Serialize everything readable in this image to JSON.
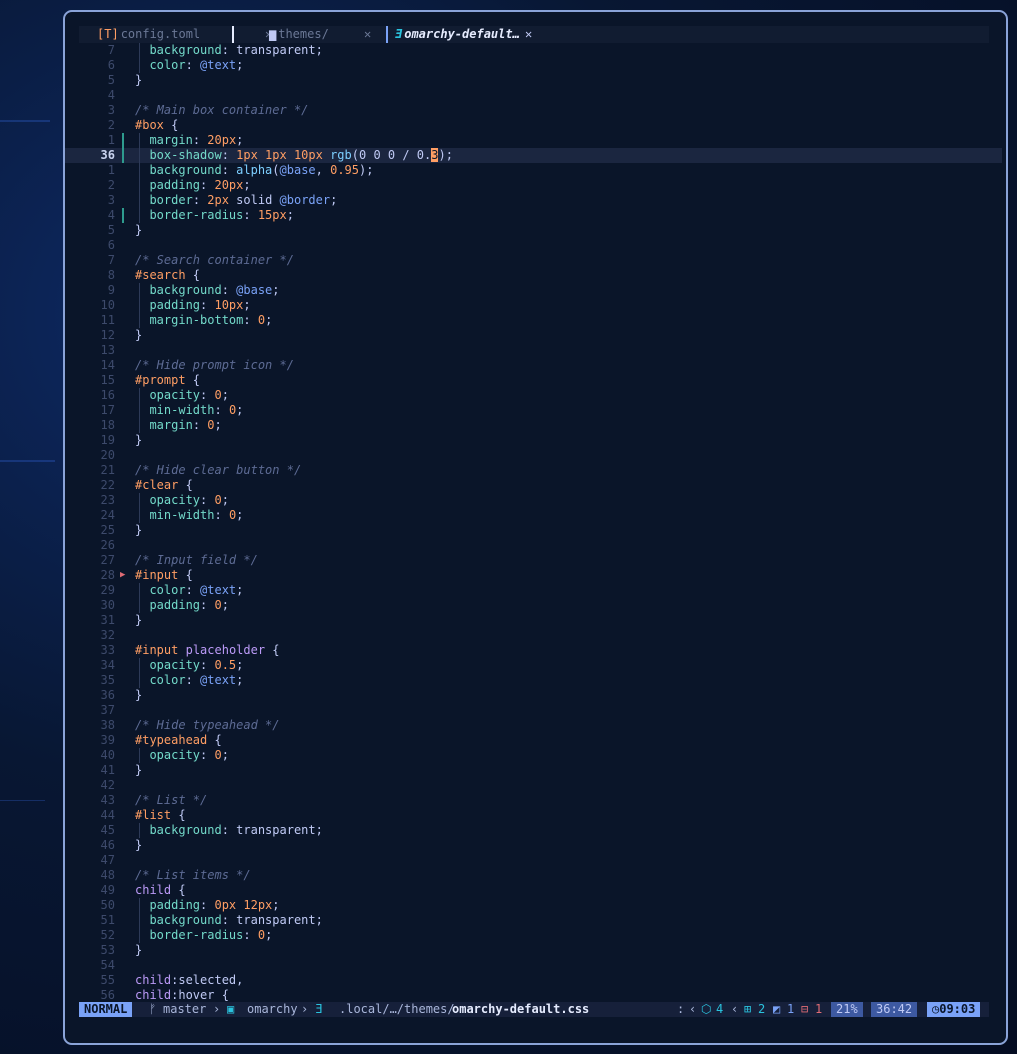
{
  "tabs": [
    {
      "icon": "[T]",
      "label": "config.toml",
      "close": "✕"
    },
    {
      "icon": "▆",
      "label": "themes/",
      "close": "✕"
    },
    {
      "icon": "Ǝ",
      "label": "omarchy-default…",
      "close": "✕"
    }
  ],
  "lines": [
    {
      "n": "7",
      "t": [
        [
          "  "
        ],
        [
          "background",
          "prop"
        ],
        [
          ": "
        ],
        [
          "transparent",
          "kw"
        ],
        [
          ";"
        ]
      ],
      "g": 1
    },
    {
      "n": "6",
      "t": [
        [
          "  "
        ],
        [
          "color",
          "prop"
        ],
        [
          ": "
        ],
        [
          "@text",
          "var"
        ],
        [
          ";"
        ]
      ],
      "g": 1
    },
    {
      "n": "5",
      "t": [
        [
          "}"
        ]
      ]
    },
    {
      "n": "4",
      "t": [
        [
          ""
        ]
      ]
    },
    {
      "n": "3",
      "t": [
        [
          "/* Main box container */",
          "cm"
        ]
      ]
    },
    {
      "n": "2",
      "t": [
        [
          "#box",
          "sel"
        ],
        [
          " {"
        ]
      ]
    },
    {
      "n": "1",
      "t": [
        [
          "  "
        ],
        [
          "margin",
          "prop"
        ],
        [
          ": "
        ],
        [
          "20px",
          "num"
        ],
        [
          ";"
        ]
      ],
      "g": 1,
      "s": 1
    },
    {
      "n": "36",
      "cur": 1,
      "t": [
        [
          "  "
        ],
        [
          "box-shadow",
          "prop"
        ],
        [
          ": "
        ],
        [
          "1px 1px 10px ",
          "num"
        ],
        [
          "rgb",
          "fn"
        ],
        [
          "(0 0 0 / 0."
        ],
        [
          "3",
          "cursor"
        ],
        [
          ");"
        ]
      ],
      "g": 1,
      "s": 1
    },
    {
      "n": "1",
      "t": [
        [
          "  "
        ],
        [
          "background",
          "prop"
        ],
        [
          ": "
        ],
        [
          "alpha",
          "fn"
        ],
        [
          "("
        ],
        [
          "@base",
          "var"
        ],
        [
          ", "
        ],
        [
          "0.95",
          "num"
        ],
        [
          ");"
        ]
      ],
      "g": 1
    },
    {
      "n": "2",
      "t": [
        [
          "  "
        ],
        [
          "padding",
          "prop"
        ],
        [
          ": "
        ],
        [
          "20px",
          "num"
        ],
        [
          ";"
        ]
      ],
      "g": 1
    },
    {
      "n": "3",
      "t": [
        [
          "  "
        ],
        [
          "border",
          "prop"
        ],
        [
          ": "
        ],
        [
          "2px",
          "num"
        ],
        [
          " solid "
        ],
        [
          "@border",
          "var"
        ],
        [
          ";"
        ]
      ],
      "g": 1
    },
    {
      "n": "4",
      "t": [
        [
          "  "
        ],
        [
          "border-radius",
          "prop"
        ],
        [
          ": "
        ],
        [
          "15px",
          "num"
        ],
        [
          ";"
        ]
      ],
      "g": 1,
      "s": 1
    },
    {
      "n": "5",
      "t": [
        [
          "}"
        ]
      ]
    },
    {
      "n": "6",
      "t": [
        [
          ""
        ]
      ]
    },
    {
      "n": "7",
      "t": [
        [
          "/* Search container */",
          "cm"
        ]
      ]
    },
    {
      "n": "8",
      "t": [
        [
          "#search",
          "sel"
        ],
        [
          " {"
        ]
      ]
    },
    {
      "n": "9",
      "t": [
        [
          "  "
        ],
        [
          "background",
          "prop"
        ],
        [
          ": "
        ],
        [
          "@base",
          "var"
        ],
        [
          ";"
        ]
      ],
      "g": 1
    },
    {
      "n": "10",
      "t": [
        [
          "  "
        ],
        [
          "padding",
          "prop"
        ],
        [
          ": "
        ],
        [
          "10px",
          "num"
        ],
        [
          ";"
        ]
      ],
      "g": 1
    },
    {
      "n": "11",
      "t": [
        [
          "  "
        ],
        [
          "margin-bottom",
          "prop"
        ],
        [
          ": "
        ],
        [
          "0",
          "num"
        ],
        [
          ";"
        ]
      ],
      "g": 1
    },
    {
      "n": "12",
      "t": [
        [
          "}"
        ]
      ]
    },
    {
      "n": "13",
      "t": [
        [
          ""
        ]
      ]
    },
    {
      "n": "14",
      "t": [
        [
          "/* Hide prompt icon */",
          "cm"
        ]
      ]
    },
    {
      "n": "15",
      "t": [
        [
          "#prompt",
          "sel"
        ],
        [
          " {"
        ]
      ]
    },
    {
      "n": "16",
      "t": [
        [
          "  "
        ],
        [
          "opacity",
          "prop"
        ],
        [
          ": "
        ],
        [
          "0",
          "num"
        ],
        [
          ";"
        ]
      ],
      "g": 1
    },
    {
      "n": "17",
      "t": [
        [
          "  "
        ],
        [
          "min-width",
          "prop"
        ],
        [
          ": "
        ],
        [
          "0",
          "num"
        ],
        [
          ";"
        ]
      ],
      "g": 1
    },
    {
      "n": "18",
      "t": [
        [
          "  "
        ],
        [
          "margin",
          "prop"
        ],
        [
          ": "
        ],
        [
          "0",
          "num"
        ],
        [
          ";"
        ]
      ],
      "g": 1
    },
    {
      "n": "19",
      "t": [
        [
          "}"
        ]
      ]
    },
    {
      "n": "20",
      "t": [
        [
          ""
        ]
      ]
    },
    {
      "n": "21",
      "t": [
        [
          "/* Hide clear button */",
          "cm"
        ]
      ]
    },
    {
      "n": "22",
      "t": [
        [
          "#clear",
          "sel"
        ],
        [
          " {"
        ]
      ]
    },
    {
      "n": "23",
      "t": [
        [
          "  "
        ],
        [
          "opacity",
          "prop"
        ],
        [
          ": "
        ],
        [
          "0",
          "num"
        ],
        [
          ";"
        ]
      ],
      "g": 1
    },
    {
      "n": "24",
      "t": [
        [
          "  "
        ],
        [
          "min-width",
          "prop"
        ],
        [
          ": "
        ],
        [
          "0",
          "num"
        ],
        [
          ";"
        ]
      ],
      "g": 1
    },
    {
      "n": "25",
      "t": [
        [
          "}"
        ]
      ]
    },
    {
      "n": "26",
      "t": [
        [
          ""
        ]
      ]
    },
    {
      "n": "27",
      "t": [
        [
          "/* Input field */",
          "cm"
        ]
      ]
    },
    {
      "n": "28",
      "f": 1,
      "t": [
        [
          "#input",
          "sel"
        ],
        [
          " {"
        ]
      ]
    },
    {
      "n": "29",
      "t": [
        [
          "  "
        ],
        [
          "color",
          "prop"
        ],
        [
          ": "
        ],
        [
          "@text",
          "var"
        ],
        [
          ";"
        ]
      ],
      "g": 1
    },
    {
      "n": "30",
      "t": [
        [
          "  "
        ],
        [
          "padding",
          "prop"
        ],
        [
          ": "
        ],
        [
          "0",
          "num"
        ],
        [
          ";"
        ]
      ],
      "g": 1
    },
    {
      "n": "31",
      "t": [
        [
          "}"
        ]
      ]
    },
    {
      "n": "32",
      "t": [
        [
          ""
        ]
      ]
    },
    {
      "n": "33",
      "t": [
        [
          "#input",
          "sel"
        ],
        [
          " "
        ],
        [
          "placeholder",
          "el"
        ],
        [
          " {"
        ]
      ]
    },
    {
      "n": "34",
      "t": [
        [
          "  "
        ],
        [
          "opacity",
          "prop"
        ],
        [
          ": "
        ],
        [
          "0.5",
          "num"
        ],
        [
          ";"
        ]
      ],
      "g": 1
    },
    {
      "n": "35",
      "t": [
        [
          "  "
        ],
        [
          "color",
          "prop"
        ],
        [
          ": "
        ],
        [
          "@text",
          "var"
        ],
        [
          ";"
        ]
      ],
      "g": 1
    },
    {
      "n": "36",
      "t": [
        [
          "}"
        ]
      ]
    },
    {
      "n": "37",
      "t": [
        [
          ""
        ]
      ]
    },
    {
      "n": "38",
      "t": [
        [
          "/* Hide typeahead */",
          "cm"
        ]
      ]
    },
    {
      "n": "39",
      "t": [
        [
          "#typeahead",
          "sel"
        ],
        [
          " {"
        ]
      ]
    },
    {
      "n": "40",
      "t": [
        [
          "  "
        ],
        [
          "opacity",
          "prop"
        ],
        [
          ": "
        ],
        [
          "0",
          "num"
        ],
        [
          ";"
        ]
      ],
      "g": 1
    },
    {
      "n": "41",
      "t": [
        [
          "}"
        ]
      ]
    },
    {
      "n": "42",
      "t": [
        [
          ""
        ]
      ]
    },
    {
      "n": "43",
      "t": [
        [
          "/* List */",
          "cm"
        ]
      ]
    },
    {
      "n": "44",
      "t": [
        [
          "#list",
          "sel"
        ],
        [
          " {"
        ]
      ]
    },
    {
      "n": "45",
      "t": [
        [
          "  "
        ],
        [
          "background",
          "prop"
        ],
        [
          ": "
        ],
        [
          "transparent",
          "kw"
        ],
        [
          ";"
        ]
      ],
      "g": 1
    },
    {
      "n": "46",
      "t": [
        [
          "}"
        ]
      ]
    },
    {
      "n": "47",
      "t": [
        [
          ""
        ]
      ]
    },
    {
      "n": "48",
      "t": [
        [
          "/* List items */",
          "cm"
        ]
      ]
    },
    {
      "n": "49",
      "t": [
        [
          "child",
          "el"
        ],
        [
          " {"
        ]
      ]
    },
    {
      "n": "50",
      "t": [
        [
          "  "
        ],
        [
          "padding",
          "prop"
        ],
        [
          ": "
        ],
        [
          "0px 12px",
          "num"
        ],
        [
          ";"
        ]
      ],
      "g": 1
    },
    {
      "n": "51",
      "t": [
        [
          "  "
        ],
        [
          "background",
          "prop"
        ],
        [
          ": "
        ],
        [
          "transparent",
          "kw"
        ],
        [
          ";"
        ]
      ],
      "g": 1
    },
    {
      "n": "52",
      "t": [
        [
          "  "
        ],
        [
          "border-radius",
          "prop"
        ],
        [
          ": "
        ],
        [
          "0",
          "num"
        ],
        [
          ";"
        ]
      ],
      "g": 1
    },
    {
      "n": "53",
      "t": [
        [
          "}"
        ]
      ]
    },
    {
      "n": "54",
      "t": [
        [
          ""
        ]
      ]
    },
    {
      "n": "55",
      "t": [
        [
          "child",
          "el"
        ],
        [
          ":selected,"
        ]
      ]
    },
    {
      "n": "56",
      "t": [
        [
          "child",
          "el"
        ],
        [
          ":hover {"
        ]
      ]
    }
  ],
  "status": {
    "mode": "NORMAL",
    "branch_icon": "ᚠ",
    "branch": "master",
    "repo_icon": "▣",
    "repo": "omarchy",
    "file_icon": "Ǝ",
    "path_prefix": ".local/…/themes/",
    "file": "omarchy-default.css",
    "colon": ":",
    "lsp_icon": "⬡",
    "lsp_count": "4",
    "added": "2",
    "changed": "1",
    "removed": "1",
    "percent": "21%",
    "position": "36:42",
    "time_icon": "◷",
    "time": "09:03"
  }
}
